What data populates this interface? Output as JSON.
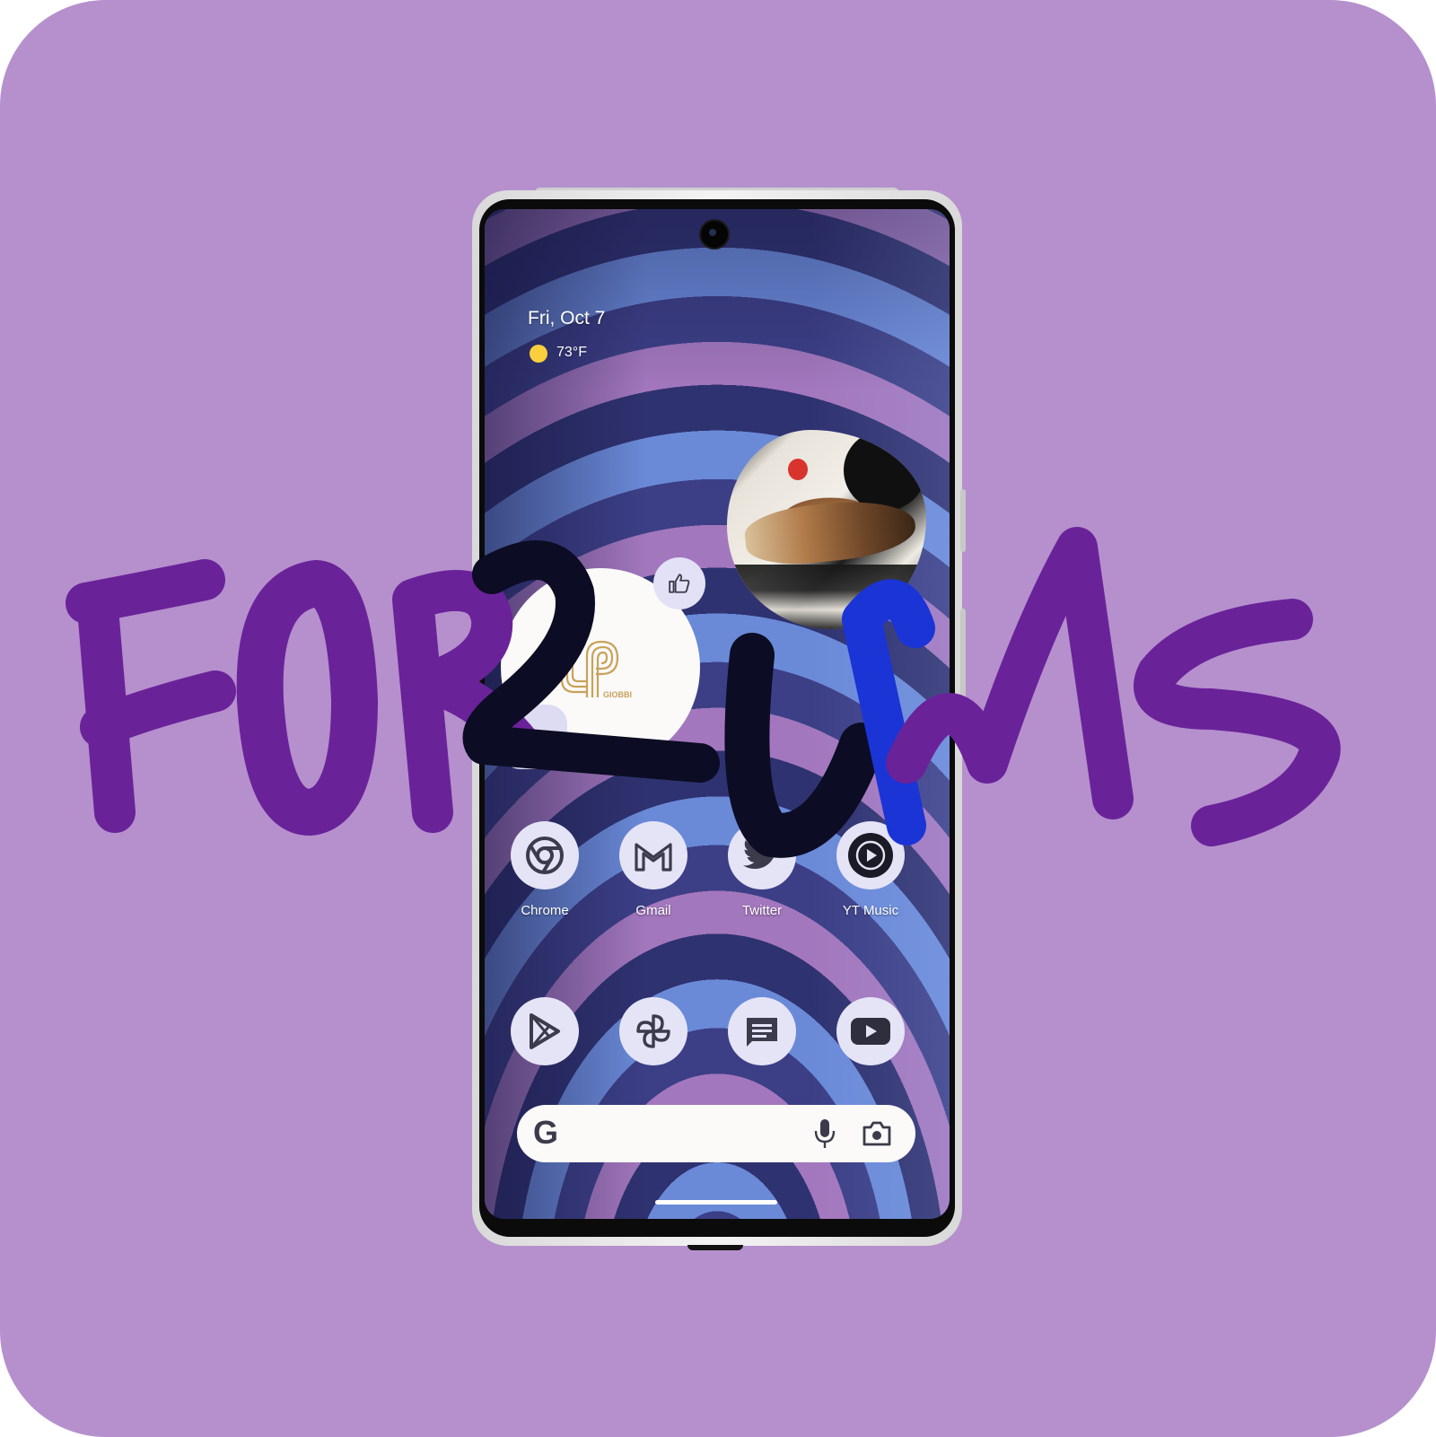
{
  "background": {
    "color": "#b590cd"
  },
  "overlay_text": {
    "word": "FORUMS",
    "second_line": "2"
  },
  "home_screen": {
    "date": "Fri, Oct 7",
    "weather": {
      "icon": "sun-icon",
      "temperature": "73°F"
    },
    "media_widget": {
      "brand": "GIOBBI",
      "like_icon": "thumbs-up-icon",
      "pause_icon": "pause-icon"
    },
    "apps_row": [
      {
        "label": "Chrome",
        "icon": "chrome-icon"
      },
      {
        "label": "Gmail",
        "icon": "gmail-icon"
      },
      {
        "label": "Twitter",
        "icon": "twitter-icon"
      },
      {
        "label": "YT Music",
        "icon": "yt-music-icon"
      }
    ],
    "dock": [
      {
        "icon": "play-store-icon"
      },
      {
        "icon": "pinwheel-icon"
      },
      {
        "icon": "messages-icon"
      },
      {
        "icon": "youtube-icon"
      }
    ],
    "search_bar": {
      "logo": "G",
      "mic_icon": "mic-icon",
      "lens_icon": "camera-lens-icon"
    }
  },
  "colors": {
    "lettering": "#6a2299",
    "lettering_dark": "#0c0c24",
    "lettering_blue": "#1a34d6",
    "icon_bg": "#e5e4f6",
    "icon_fg": "#3c3b4c"
  }
}
